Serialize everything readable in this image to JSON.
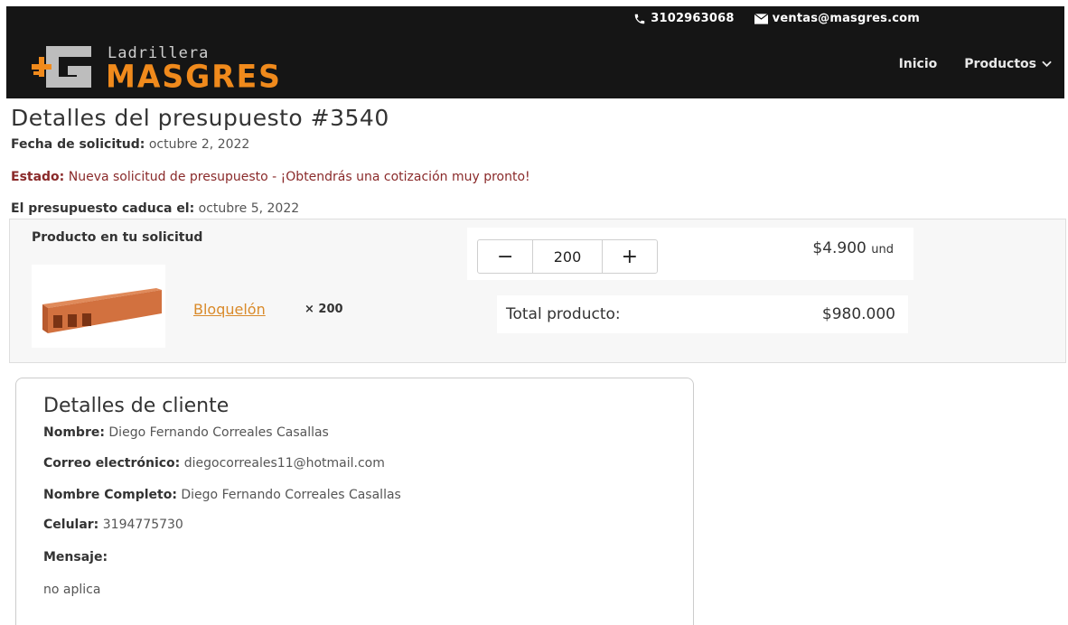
{
  "topbar": {
    "phone": "3102963068",
    "email": "ventas@masgres.com"
  },
  "logo": {
    "small": "Ladrillera",
    "big": "MASGRES"
  },
  "nav": {
    "items": [
      "Inicio",
      "Productos"
    ]
  },
  "quote": {
    "title": "Detalles del presupuesto #3540",
    "request_date_label": "Fecha de solicitud:",
    "request_date": "octubre 2, 2022",
    "status_label": "Estado:",
    "status": "Nueva solicitud de presupuesto - ¡Obtendrás una cotización muy pronto!",
    "expires_label": "El presupuesto caduca el:",
    "expires": "octubre 5, 2022"
  },
  "product": {
    "panel_title": "Producto en tu solicitud",
    "name": "Bloquelón",
    "qty_text": "× 200",
    "stepper_minus": "−",
    "stepper_value": "200",
    "stepper_plus": "+",
    "unit_price": "$4.900",
    "unit": "und",
    "total_label": "Total producto:",
    "total_value": "$980.000"
  },
  "client": {
    "title": "Detalles de cliente",
    "name_label": "Nombre:",
    "name": "Diego Fernando Correales Casallas",
    "email_label": "Correo electrónico:",
    "email": "diegocorreales11@hotmail.com",
    "fullname_label": "Nombre Completo:",
    "fullname": "Diego Fernando Correales Casallas",
    "phone_label": "Celular:",
    "phone": "3194775730",
    "message_label": "Mensaje:",
    "message": "no aplica"
  },
  "colors": {
    "header_bg": "#151515",
    "brand_orange": "#f08a1c",
    "link_orange": "#d98a2a",
    "status_red": "#8a2a2a"
  }
}
